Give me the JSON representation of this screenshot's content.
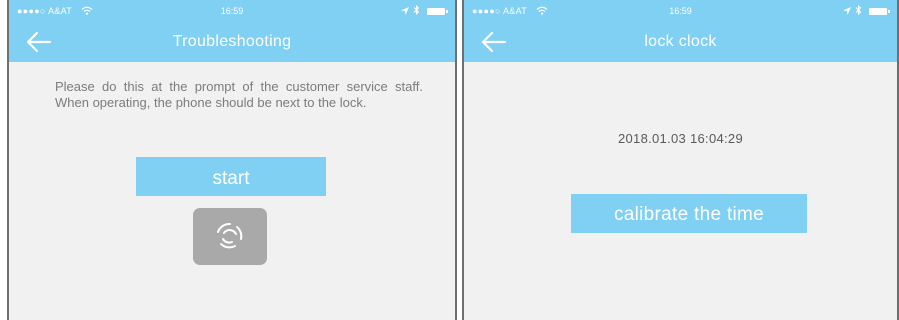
{
  "screens": [
    {
      "status_bar": {
        "carrier": "●●●●○ A&AT",
        "time": "16:59"
      },
      "nav": {
        "title": "Troubleshooting"
      },
      "instructions": "Please do this at the prompt of the customer service staff. When operating, the phone should be next to the lock.",
      "start_label": "start"
    },
    {
      "status_bar": {
        "carrier": "●●●●○ A&AT",
        "time": "16:59"
      },
      "nav": {
        "title": "lock clock"
      },
      "datetime": "2018.01.03 16:04:29",
      "calibrate_label": "calibrate the time"
    }
  ],
  "colors": {
    "accent": "#7fd0f3",
    "background": "#f1f1f1",
    "text_muted": "#7c7c7c",
    "icon_box": "#a9a9a9"
  },
  "icons": [
    "wifi-icon",
    "location-arrow-icon",
    "bluetooth-icon",
    "battery-icon",
    "back-arrow-icon",
    "loading-spinner-icon"
  ]
}
